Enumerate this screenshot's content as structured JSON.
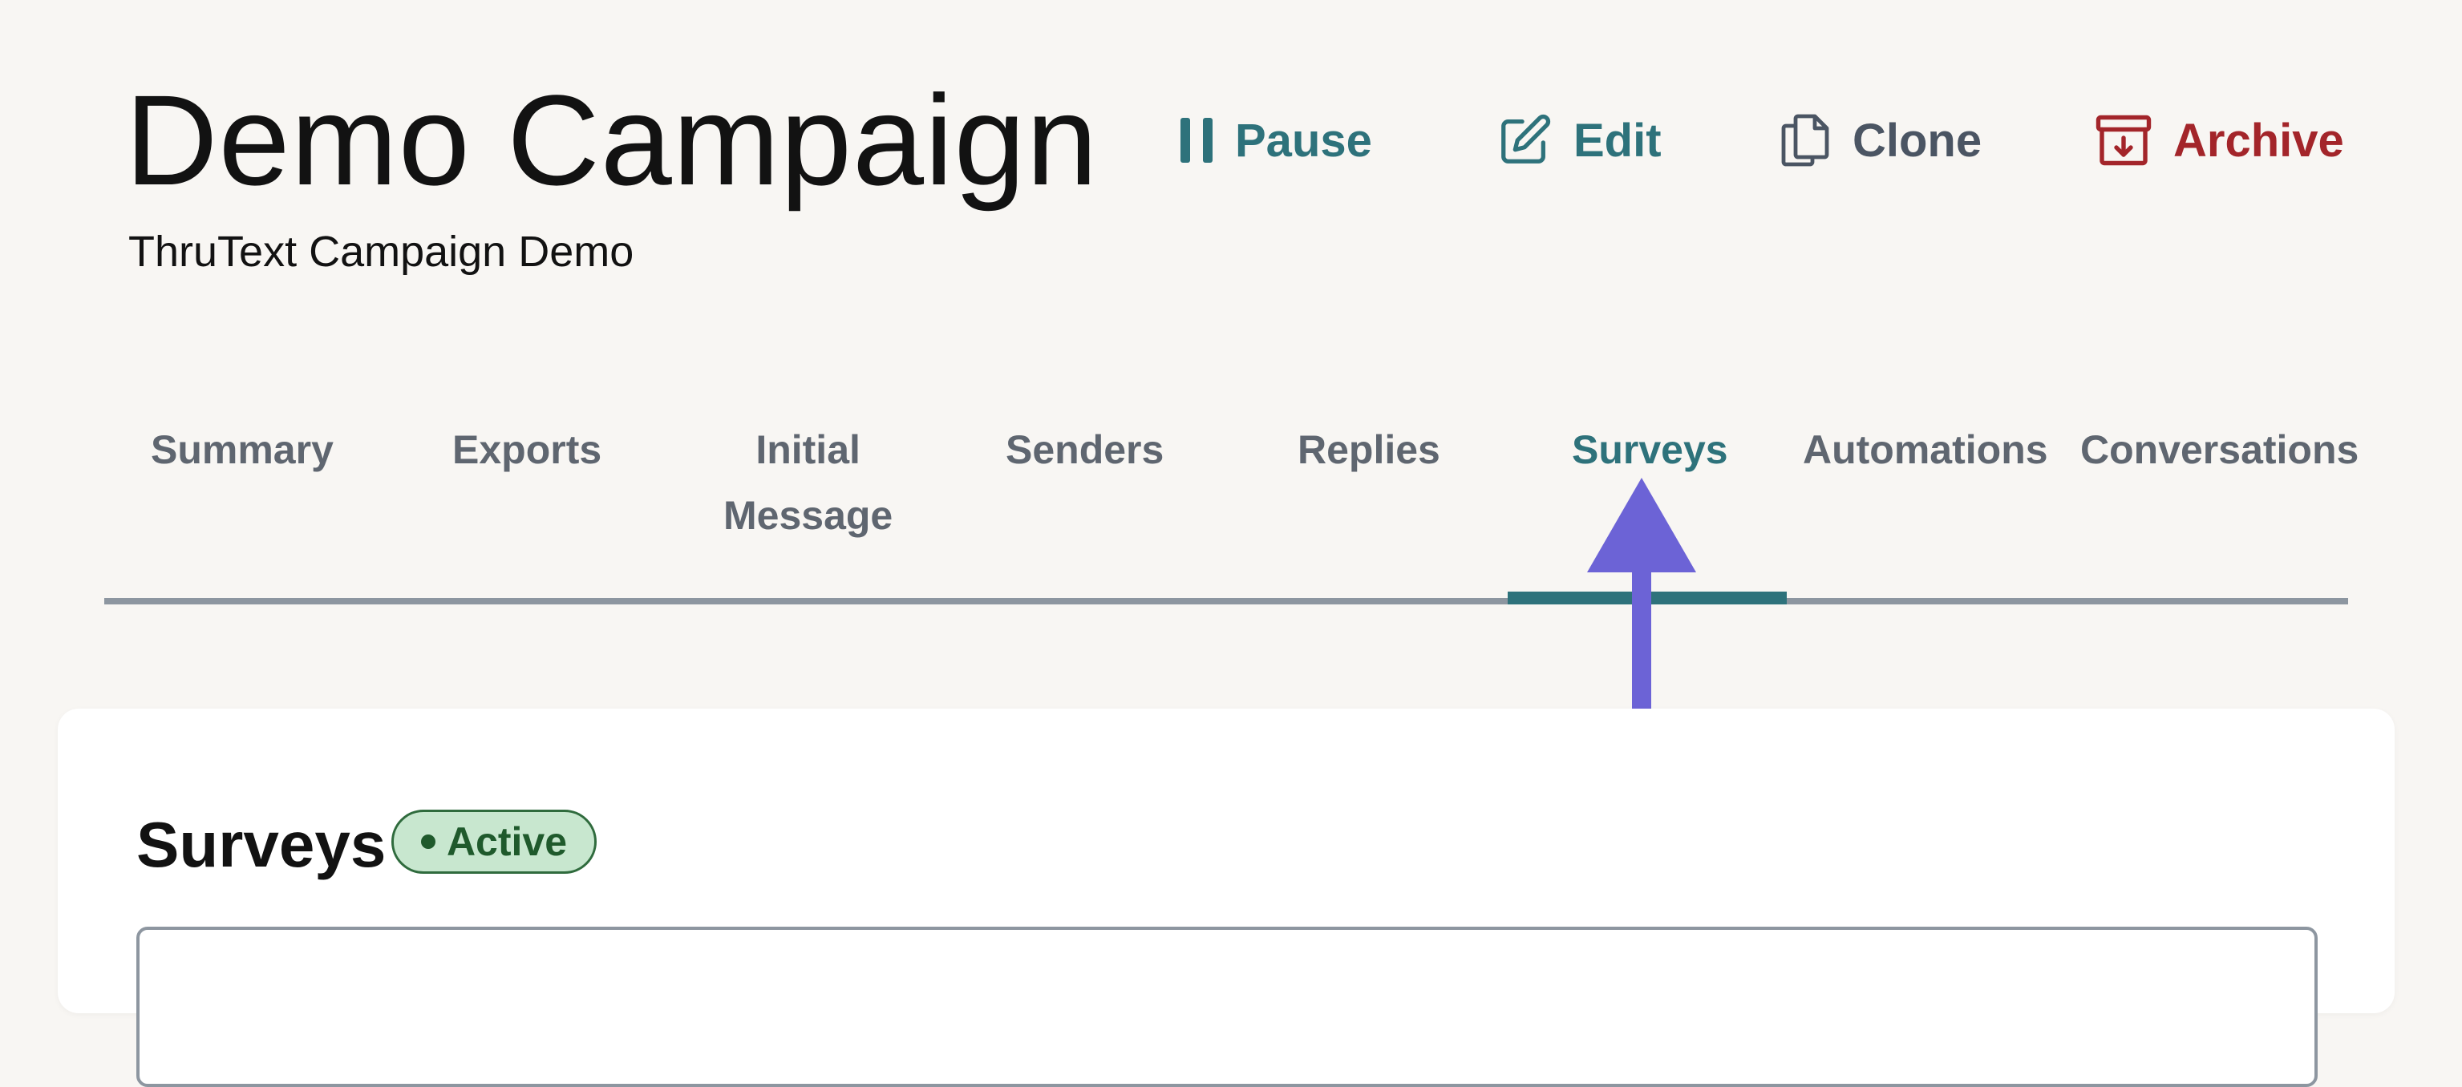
{
  "campaign": {
    "title": "Demo Campaign",
    "subtitle": "ThruText Campaign Demo"
  },
  "actions": {
    "pause": "Pause",
    "edit": "Edit",
    "clone": "Clone",
    "archive": "Archive"
  },
  "tabs": [
    {
      "label": "Summary"
    },
    {
      "label": "Exports"
    },
    {
      "label": "Initial",
      "label2": "Message"
    },
    {
      "label": "Senders"
    },
    {
      "label": "Replies"
    },
    {
      "label": "Surveys",
      "active": true
    },
    {
      "label": "Automations"
    },
    {
      "label": "Conversations"
    }
  ],
  "section": {
    "title": "Surveys",
    "status": "Active"
  },
  "colors": {
    "accent": "#2e727b",
    "danger": "#a3252a",
    "status_bg": "#c8e7cf",
    "annotation_arrow": "#6c63d6"
  },
  "icons": {
    "pause": "pause-icon",
    "edit": "edit-icon",
    "clone": "clone-icon",
    "archive": "archive-icon"
  }
}
